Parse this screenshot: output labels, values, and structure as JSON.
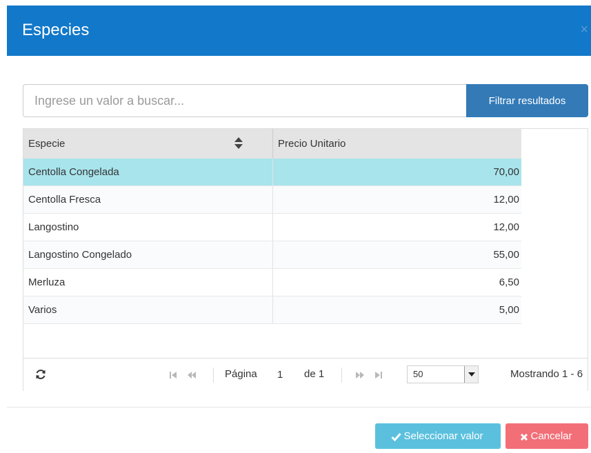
{
  "modal": {
    "title": "Especies",
    "close_label": "×"
  },
  "search": {
    "placeholder": "Ingrese un valor a buscar...",
    "value": "",
    "filter_label": "Filtrar resultados"
  },
  "grid": {
    "columns": [
      "Especie",
      "Precio Unitario"
    ],
    "sorted_column": "Especie",
    "rows": [
      {
        "especie": "Centolla Congelada",
        "precio": "70,00",
        "selected": true
      },
      {
        "especie": "Centolla Fresca",
        "precio": "12,00",
        "selected": false
      },
      {
        "especie": "Langostino",
        "precio": "12,00",
        "selected": false
      },
      {
        "especie": "Langostino Congelado",
        "precio": "55,00",
        "selected": false
      },
      {
        "especie": "Merluza",
        "precio": "6,50",
        "selected": false
      },
      {
        "especie": "Varios",
        "precio": "5,00",
        "selected": false
      }
    ]
  },
  "pager": {
    "page_label": "Página",
    "page_value": "1",
    "of_label": "de 1",
    "page_size": "50",
    "showing": "Mostrando 1 - 6"
  },
  "footer": {
    "select_label": "Seleccionar valor",
    "cancel_label": "Cancelar"
  },
  "icons": {
    "refresh": "refresh-icon",
    "first": "first-page-icon",
    "prev": "prev-page-icon",
    "next": "next-page-icon",
    "last": "last-page-icon",
    "check": "check-icon",
    "cancel": "times-icon",
    "sort": "sort-icon"
  },
  "colors": {
    "header": "#1278c9",
    "filter_button": "#337ab7",
    "selected_row": "#a8e4ec",
    "select_button": "#5bc0de",
    "cancel_button": "#f26f78"
  }
}
